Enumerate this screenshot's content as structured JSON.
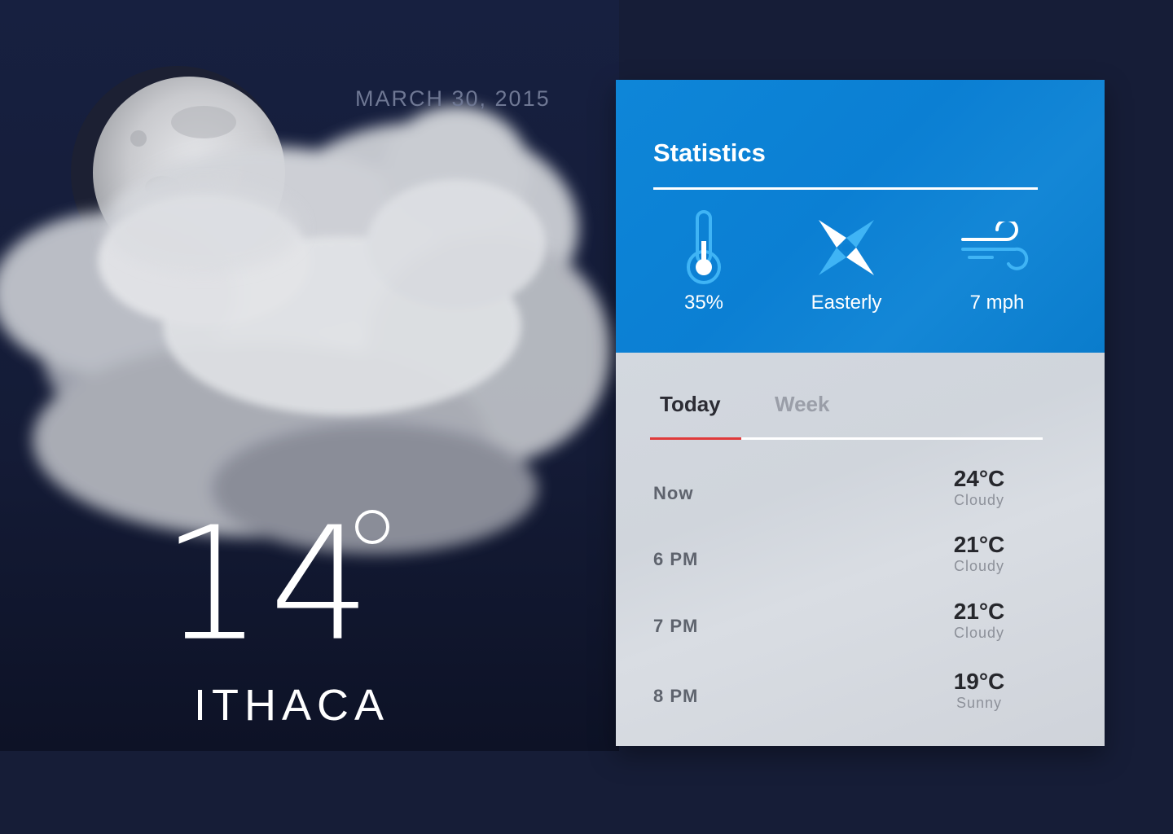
{
  "date": "MARCH 30, 2015",
  "current": {
    "temperature": "14",
    "city": "ITHACA"
  },
  "statistics": {
    "title": "Statistics",
    "items": [
      {
        "icon": "thermometer-icon",
        "value": "35%"
      },
      {
        "icon": "compass-icon",
        "value": "Easterly"
      },
      {
        "icon": "wind-icon",
        "value": "7 mph"
      }
    ]
  },
  "forecast": {
    "tabs": [
      {
        "label": "Today",
        "active": true
      },
      {
        "label": "Week",
        "active": false
      }
    ],
    "rows": [
      {
        "time": "Now",
        "temp": "24°C",
        "condition": "Cloudy"
      },
      {
        "time": "6 PM",
        "temp": "21°C",
        "condition": "Cloudy"
      },
      {
        "time": "7 PM",
        "temp": "21°C",
        "condition": "Cloudy"
      },
      {
        "time": "8 PM",
        "temp": "19°C",
        "condition": "Sunny"
      }
    ]
  },
  "colors": {
    "background": "#161d37",
    "stats_panel": "#0b7fd3",
    "forecast_panel": "#d3d8df",
    "icon_blue": "#3fb4f5",
    "tab_active_underline": "#e03a3a"
  }
}
